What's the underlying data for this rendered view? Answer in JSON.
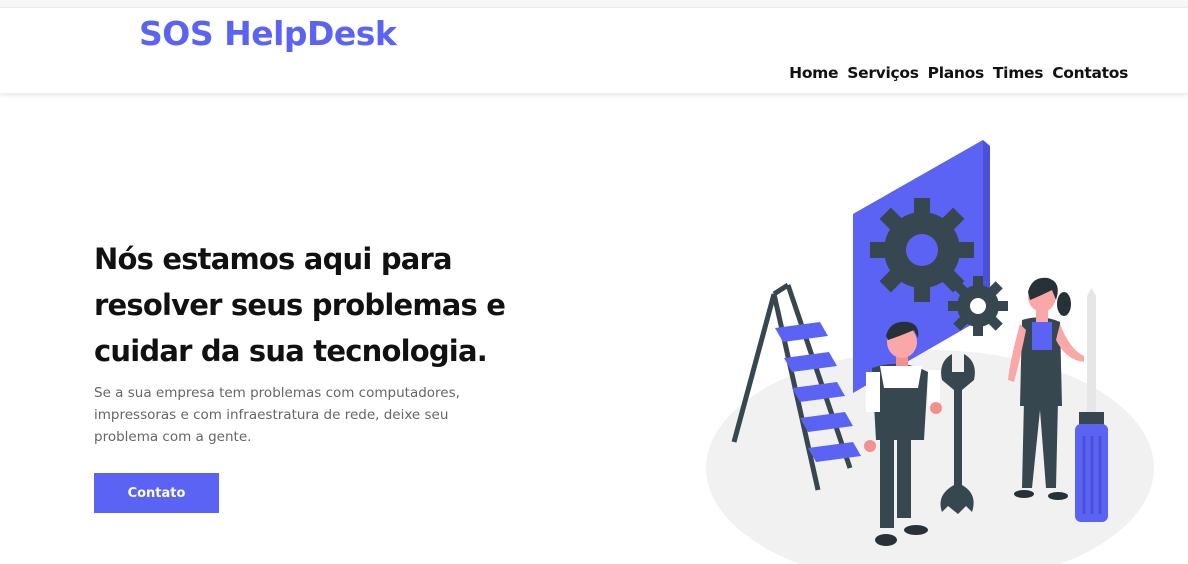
{
  "header": {
    "brand": "SOS HelpDesk",
    "nav": [
      {
        "label": "Home"
      },
      {
        "label": "Serviços"
      },
      {
        "label": "Planos"
      },
      {
        "label": "Times"
      },
      {
        "label": "Contatos"
      }
    ]
  },
  "hero": {
    "headline": [
      "Nós estamos aqui para",
      "resolver seus problemas e",
      "cuidar da sua tecnologia."
    ],
    "description": "Se a sua empresa tem problemas com computadores, impressoras e com infraestratura de rede, deixe seu problema com a gente.",
    "cta_label": "Contato"
  },
  "illustration": {
    "icons": [
      "gear-icon",
      "wrench-icon",
      "screwdriver-icon",
      "ladder-icon"
    ]
  },
  "colors": {
    "accent": "#5b63f5",
    "text": "#111111",
    "muted": "#666666",
    "dark_gray": "#37474f"
  }
}
